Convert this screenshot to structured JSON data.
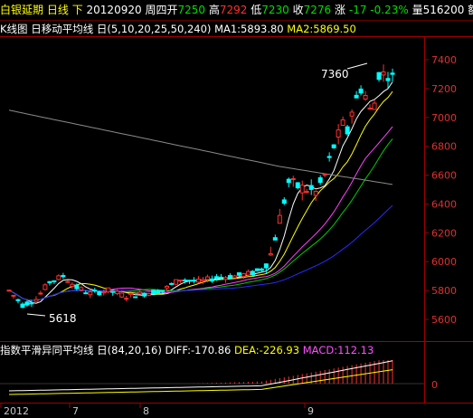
{
  "header": {
    "name": "白银延期",
    "period": "日线",
    "direction": "下",
    "date": "20120920",
    "weekday": "周四",
    "open_label": "开",
    "open": "7250",
    "high_label": "高",
    "high": "7292",
    "low_label": "低",
    "low": "7230",
    "close_label": "收",
    "close": "7276",
    "change_label": "涨",
    "change": "-17",
    "change_pct": "-0.23%",
    "volume_label": "量",
    "volume": "516200",
    "amount_label": "额"
  },
  "kline_bar": {
    "label": "K线图",
    "ma_box": "日",
    "ma_name": "移动平均线",
    "ma_box2": "日",
    "ma_params": "(5,10,20,25,50,240)",
    "ma1": "MA1:5893.80",
    "ma2": "MA2:5869.50"
  },
  "macd_bar": {
    "label": "指数平滑异同平均线",
    "box": "日",
    "params": "(84,20,16)",
    "diff": "DIFF:-170.86",
    "dea": "DEA:-226.93",
    "macd": "MACD:112.13"
  },
  "annotations": {
    "high": "7360",
    "low": "5618"
  },
  "y_axis": [
    "7400",
    "7200",
    "7000",
    "6800",
    "6600",
    "6400",
    "6200",
    "6000",
    "5800",
    "5600"
  ],
  "macd_axis": [
    "0"
  ],
  "x_axis": [
    "2012",
    "7",
    "8",
    "9"
  ],
  "colors": {
    "up": "#ff3030",
    "down": "#00ffff",
    "ma1": "#ffffff",
    "ma2": "#ffff00",
    "ma3": "#ff40ff",
    "ma4": "#00cc00",
    "ma5": "#2a2aff",
    "ma6": "#8a8a8a",
    "axis": "#a00000"
  }
}
